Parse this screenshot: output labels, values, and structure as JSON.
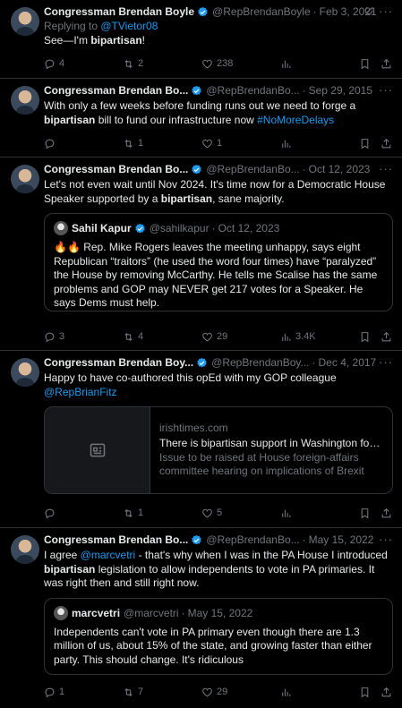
{
  "tweets": [
    {
      "name": "Congressman Brendan Boyle",
      "handle": "@RepBrendanBoyle",
      "date": "Feb 3, 2021",
      "replying_prefix": "Replying to ",
      "replying_to": "@TVietor08",
      "text_a": "See—I'm ",
      "text_b": "bipartisan",
      "text_c": "!",
      "replies": "4",
      "retweets": "2",
      "likes": "238",
      "views": ""
    },
    {
      "name": "Congressman Brendan Bo...",
      "handle": "@RepBrendanBo...",
      "date": "Sep 29, 2015",
      "text_a": "With only a few weeks before funding runs out we need to forge a ",
      "text_b": "bipartisan",
      "text_c": " bill to fund our infrastructure now ",
      "hashtag": "#NoMoreDelays",
      "replies": "",
      "retweets": "1",
      "likes": "1",
      "views": ""
    },
    {
      "name": "Congressman Brendan Bo...",
      "handle": "@RepBrendanBo...",
      "date": "Oct 12, 2023",
      "text_a": "Let's not even wait until Nov 2024. It's time now for a Democratic House Speaker supported by a ",
      "text_b": "bipartisan",
      "text_c": ", sane majority.",
      "quote": {
        "name": "Sahil Kapur",
        "handle": "@sahilkapur",
        "date": "Oct 12, 2023",
        "text": "🔥🔥 Rep. Mike Rogers leaves the meeting unhappy, says eight Republican “traitors” (he used the word four times) have “paralyzed” the House by removing McCarthy. He tells me Scalise has the same problems and GOP may NEVER get 217 votes for a Speaker. He says Dems must help."
      },
      "replies": "3",
      "retweets": "4",
      "likes": "29",
      "views": "3.4K"
    },
    {
      "name": "Congressman Brendan Boy...",
      "handle": "@RepBrendanBoy...",
      "date": "Dec 4, 2017",
      "text_a": "Happy to have co-authored this opEd with my GOP colleague ",
      "mention": "@RepBrianFitz",
      "card": {
        "domain": "irishtimes.com",
        "title": "There is bipartisan support in Washington for Irish ...",
        "desc": "Issue to be raised at House foreign-affairs committee hearing on implications of Brexit"
      },
      "replies": "",
      "retweets": "1",
      "likes": "5",
      "views": ""
    },
    {
      "name": "Congressman Brendan Bo...",
      "handle": "@RepBrendanBo...",
      "date": "May 15, 2022",
      "text_a": "I agree ",
      "mention": "@marcvetri",
      "text_b": " - that's why when I was in the PA House I introduced ",
      "text_bold": "bipartisan",
      "text_c": " legislation to allow independents to vote in PA primaries. It was right then and still right now.",
      "quote": {
        "name": "marcvetri",
        "handle": "@marcvetri",
        "date": "May 15, 2022",
        "text": "Independents can't vote in PA primary even though there are 1.3 million of us, about 15% of the state, and growing faster than either party. This should change. It's ridiculous"
      },
      "replies": "1",
      "retweets": "7",
      "likes": "29",
      "views": ""
    }
  ],
  "dot": "·",
  "more": "···",
  "colors": {
    "accent": "#1d9bf0",
    "muted": "#71767b",
    "text": "#e7e9ea",
    "border": "#2f3336",
    "background": "#000000"
  }
}
